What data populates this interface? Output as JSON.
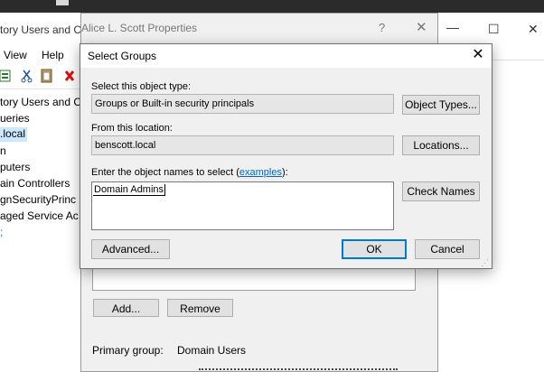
{
  "aduc": {
    "title": "tory Users and C",
    "menu": {
      "view": "View",
      "help": "Help"
    },
    "tree": [
      "tory Users and C",
      "ueries",
      ".local",
      "n",
      "puters",
      "ain Controllers",
      "gnSecurityPrinc",
      "aged Service Ac",
      ";"
    ]
  },
  "properties": {
    "title": "Alice L. Scott Properties",
    "help_glyph": "?",
    "close_glyph": "✕",
    "add_label": "Add...",
    "remove_label": "Remove",
    "primary_group_label": "Primary group:",
    "primary_group_value": "Domain Users"
  },
  "select_groups": {
    "title": "Select Groups",
    "close_glyph": "✕",
    "object_type_label": "Select this object type:",
    "object_type_value": "Groups or Built-in security principals",
    "object_types_button": "Object Types...",
    "location_label": "From this location:",
    "location_value": "benscott.local",
    "locations_button": "Locations...",
    "names_label_prefix": "Enter the object names to select (",
    "names_label_link": "examples",
    "names_label_suffix": "):",
    "names_value": "Domain Admins",
    "check_names_button": "Check Names",
    "advanced_button": "Advanced...",
    "ok_button": "OK",
    "cancel_button": "Cancel"
  },
  "right_window": {
    "minimize_glyph": "—",
    "maximize_glyph": "☐",
    "close_glyph": "✕"
  }
}
